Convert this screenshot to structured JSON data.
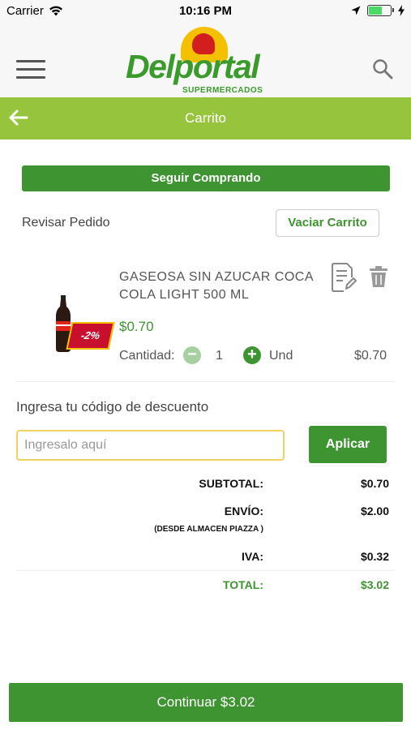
{
  "status_bar": {
    "carrier": "Carrier",
    "time": "10:16 PM",
    "battery_level": 0.6
  },
  "header": {
    "logo_text": "Delportal",
    "logo_subtext": "SUPERMERCADOS",
    "menu_icon": "hamburger-icon",
    "search_icon": "search-icon"
  },
  "title_bar": {
    "title": "Carrito",
    "back_icon": "arrow-left-icon"
  },
  "cart": {
    "continue_shopping_label": "Seguir Comprando",
    "review_label": "Revisar Pedido",
    "empty_cart_label": "Vaciar Carrito"
  },
  "product": {
    "name": "GASEOSA SIN AZUCAR COCA COLA LIGHT 500 ML",
    "discount_badge": "-2%",
    "price": "$0.70",
    "quantity_label": "Cantidad:",
    "quantity": "1",
    "unit": "Und",
    "line_total": "$0.70"
  },
  "discount": {
    "label": "Ingresa tu código de descuento",
    "placeholder": "Ingresalo aquí",
    "value": "",
    "apply_label": "Aplicar"
  },
  "summary": {
    "subtotal_label": "SUBTOTAL:",
    "subtotal_value": "$0.70",
    "shipping_label": "ENVÍO:",
    "shipping_value": "$2.00",
    "shipping_note": "(DESDE ALMACEN PIAZZA )",
    "tax_label": "IVA:",
    "tax_value": "$0.32",
    "total_label": "TOTAL:",
    "total_value": "$3.02"
  },
  "footer": {
    "continue_label": "Continuar $3.02"
  },
  "colors": {
    "brand_green": "#3e9430",
    "title_bar_green": "#96c43d",
    "badge_red": "#c8102e",
    "input_border": "#f0d360"
  }
}
